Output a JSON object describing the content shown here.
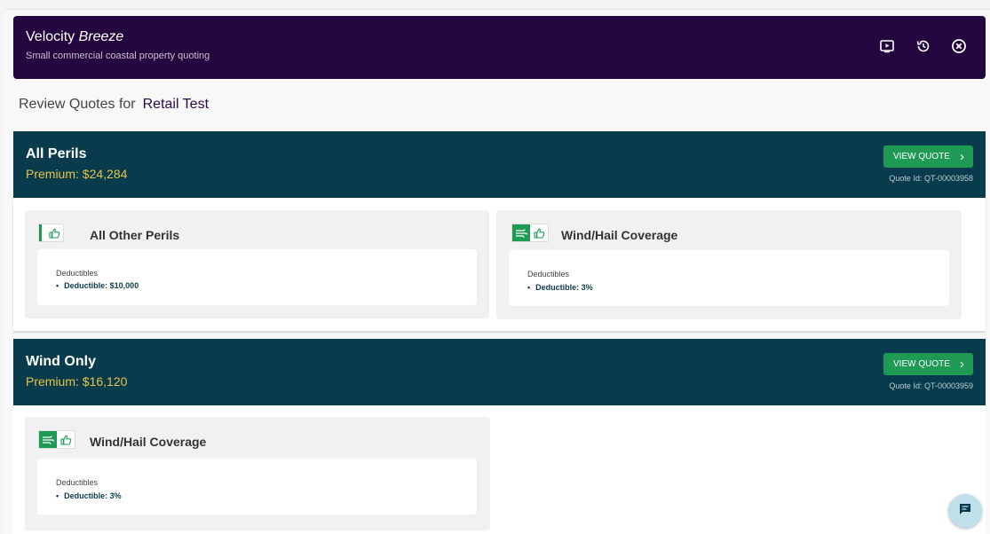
{
  "header": {
    "brand_main": "Velocity",
    "brand_italic": "Breeze",
    "subtitle": "Small commercial coastal property quoting",
    "icons": [
      "play-icon",
      "history-icon",
      "close-circle-icon"
    ]
  },
  "review": {
    "prefix": "Review Quotes for",
    "name": "Retail Test"
  },
  "quotes": [
    {
      "title": "All Perils",
      "premium": "Premium: $24,284",
      "button_label": "VIEW QUOTE",
      "quote_id": "Quote Id: QT-00003958",
      "coverages": [
        {
          "title": "All Other Perils",
          "deductibles_label": "Deductibles",
          "deductible": "Deductible: $10,000"
        },
        {
          "title": "Wind/Hail Coverage",
          "deductibles_label": "Deductibles",
          "deductible": "Deductible: 3%"
        }
      ]
    },
    {
      "title": "Wind Only",
      "premium": "Premium: $16,120",
      "button_label": "VIEW QUOTE",
      "quote_id": "Quote Id: QT-00003959",
      "coverages": [
        {
          "title": "Wind/Hail Coverage",
          "deductibles_label": "Deductibles",
          "deductible": "Deductible: 3%"
        }
      ]
    }
  ],
  "colors": {
    "header_bg": "#24073f",
    "quote_header_bg": "#083c4c",
    "premium_text": "#e6c34a",
    "button_green": "#1f9a55"
  }
}
